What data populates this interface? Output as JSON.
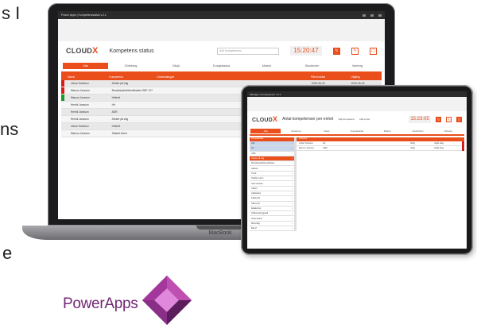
{
  "slide_fragments": [
    "s I",
    "ns",
    "e"
  ],
  "laptop": {
    "brand_label": "MacBook",
    "titlebar": "Power Apps | Kompetensstatus v.2.1",
    "header": {
      "logo_text": "CLOUD",
      "logo_x": "X",
      "title": "Kompetens status",
      "search_placeholder": "Sök kompetensen",
      "clock": "15:20:47"
    },
    "tabs": [
      {
        "label": "Alla",
        "active": true
      },
      {
        "label": "Göteborg",
        "active": false
      },
      {
        "label": "Växjö",
        "active": false
      },
      {
        "label": "Kungsbacka",
        "active": false
      },
      {
        "label": "Malmö",
        "active": false
      },
      {
        "label": "Stockholm",
        "active": false
      },
      {
        "label": "Varberg",
        "active": false
      }
    ],
    "columns": [
      "Namn",
      "Kompetens",
      "Underkategori",
      "Påminnelse",
      "Utgång"
    ],
    "rows": [
      {
        "flag": "#d71a1a",
        "name": "Johan Karlsson",
        "comp": "Arbete på väg",
        "sub": "",
        "remind": "2020-05-20",
        "expire": "2020-06-20"
      },
      {
        "flag": "#d71a1a",
        "name": "Marcus Jansson",
        "comp": "Brandskyddsföreståndare SBF 127",
        "sub": "",
        "remind": "",
        "expire": ""
      },
      {
        "flag": "#1a9a2a",
        "name": "Marcus Jansson",
        "comp": "Heltrett",
        "sub": "",
        "remind": "",
        "expire": ""
      },
      {
        "flag": "",
        "name": "Henrik Jansson",
        "comp": "Hlr",
        "sub": "",
        "remind": "",
        "expire": ""
      },
      {
        "flag": "",
        "name": "Henrik Jansson",
        "comp": "ADR",
        "sub": "",
        "remind": "",
        "expire": ""
      },
      {
        "flag": "",
        "name": "Henrik Jansson",
        "comp": "Arbete på väg",
        "sub": "",
        "remind": "",
        "expire": ""
      },
      {
        "flag": "",
        "name": "Johan Karlsson",
        "comp": "Heltrett",
        "sub": "",
        "remind": "",
        "expire": ""
      },
      {
        "flag": "",
        "name": "Marcus Jansson",
        "comp": "Stadiet intern",
        "sub": "",
        "remind": "",
        "expire": ""
      }
    ]
  },
  "tablet": {
    "titlebar": "Manager | Kompetenser v.2.1",
    "header": {
      "logo_text": "CLOUD",
      "logo_x": "X",
      "title": "Antal kompetenser per enhet",
      "select1": "Välj kompetens",
      "select2": "Välj enhet",
      "clock": "15:23:05"
    },
    "tabs": [
      {
        "label": "Alla",
        "active": true
      },
      {
        "label": "Göteborg",
        "active": false
      },
      {
        "label": "Växjö",
        "active": false
      },
      {
        "label": "Kungsbacka",
        "active": false
      },
      {
        "label": "Malmö",
        "active": false
      },
      {
        "label": "Stockholm",
        "active": false
      },
      {
        "label": "Varberg",
        "active": false
      }
    ],
    "side_head": "Kompetenser",
    "side_items": [
      {
        "label": "Alla",
        "state": "sel"
      },
      {
        "label": "Hlr",
        "state": "sel"
      },
      {
        "label": "ADR",
        "state": ""
      },
      {
        "label": "Arbete på väg",
        "state": "act"
      },
      {
        "label": "Brandskyddsföreståndare",
        "state": ""
      },
      {
        "label": "Heltrett",
        "state": ""
      },
      {
        "label": "Truck",
        "state": ""
      },
      {
        "label": "Stadiet intern",
        "state": ""
      },
      {
        "label": "Heta arbeten",
        "state": ""
      },
      {
        "label": "Liftkort",
        "state": ""
      },
      {
        "label": "Hjullastare",
        "state": ""
      },
      {
        "label": "Fallskydd",
        "state": ""
      },
      {
        "label": "Säkra lyft",
        "state": ""
      },
      {
        "label": "Elsäkerhet",
        "state": ""
      },
      {
        "label": "Ställningsbyggnad",
        "state": ""
      },
      {
        "label": "Grävmaskin",
        "state": ""
      },
      {
        "label": "Motorsåg",
        "state": ""
      },
      {
        "label": "Bas-P",
        "state": ""
      }
    ],
    "main_head": "Personer",
    "main_rows": [
      {
        "name": "Johan Karlsson",
        "comp": "Hlr",
        "status": "Giltig",
        "date": "Utgår idag"
      },
      {
        "name": "Marcus Jansson",
        "comp": "ADR",
        "status": "Giltig",
        "date": "Utgår idag"
      }
    ]
  },
  "powerapps": {
    "label": "PowerApps"
  }
}
